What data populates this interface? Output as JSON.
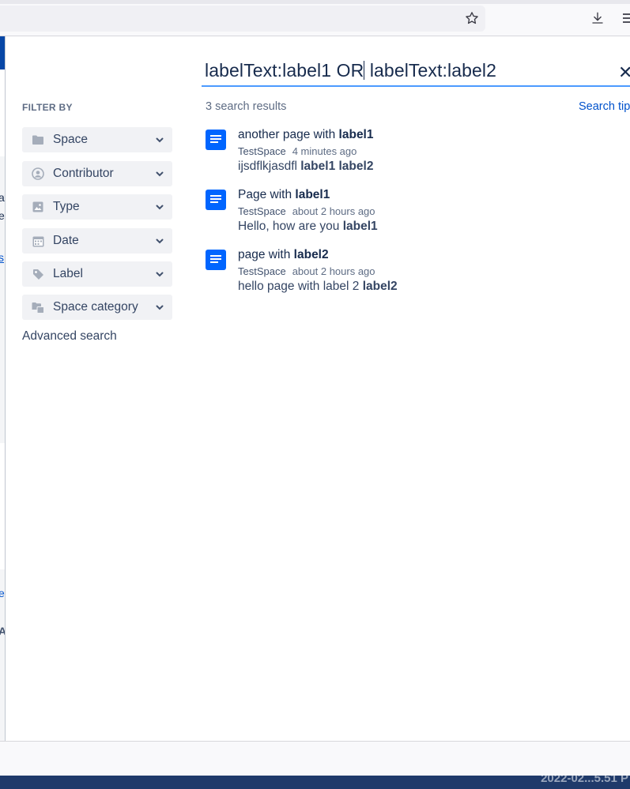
{
  "browser": {
    "star_icon": "star-icon",
    "download_icon": "download-icon",
    "menu_icon": "hamburger-menu-icon"
  },
  "background_fragments": [
    "av",
    "e",
    "s",
    "e",
    "A"
  ],
  "search": {
    "query_part1": "labelText:label1 OR",
    "query_part2": " labelText:label2"
  },
  "filters": {
    "heading": "FILTER BY",
    "items": [
      {
        "label": "Space",
        "icon": "folder-icon"
      },
      {
        "label": "Contributor",
        "icon": "user-icon"
      },
      {
        "label": "Type",
        "icon": "image-icon"
      },
      {
        "label": "Date",
        "icon": "calendar-icon"
      },
      {
        "label": "Label",
        "icon": "tag-icon"
      },
      {
        "label": "Space category",
        "icon": "folder-category-icon"
      }
    ],
    "advanced": "Advanced search"
  },
  "results": {
    "count_text": "3 search results",
    "tips": "Search tips",
    "items": [
      {
        "title_pre": "another page with ",
        "title_bold": "label1",
        "space": "TestSpace",
        "time": "4 minutes ago",
        "snippet_pre": "ijsdflkjasdfl ",
        "snippet_bold": "label1 label2"
      },
      {
        "title_pre": "Page with ",
        "title_bold": "label1",
        "space": "TestSpace",
        "time": "about 2 hours ago",
        "snippet_pre": "Hello, how are you ",
        "snippet_bold": "label1"
      },
      {
        "title_pre": "page with ",
        "title_bold": "label2",
        "space": "TestSpace",
        "time": "about 2 hours ago",
        "snippet_pre": "hello page with label 2 ",
        "snippet_bold": "label2"
      }
    ]
  },
  "taskbar": {
    "clock": "2022-02...5.51 P"
  },
  "colors": {
    "accent": "#0052cc",
    "doc_icon": "#0065ff",
    "focus_underline": "#4c9aff"
  }
}
